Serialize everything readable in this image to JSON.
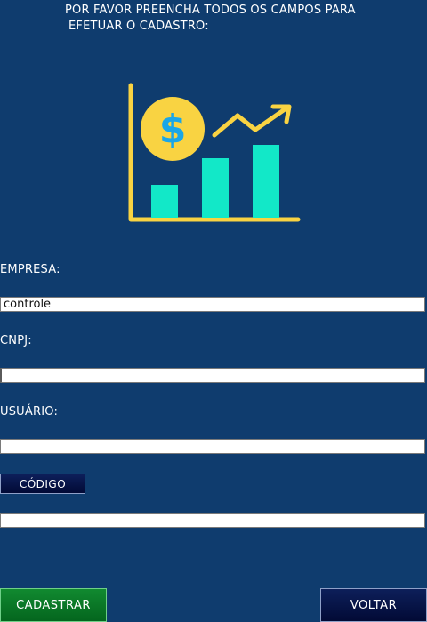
{
  "header": {
    "instruction_line1": "POR FAVOR PREENCHA TODOS OS CAMPOS PARA",
    "instruction_line2": "EFETUAR O CADASTRO:"
  },
  "logo": {
    "icon": "finance-growth-chart-icon",
    "colors": {
      "axis": "#f9d342",
      "coin": "#f9d342",
      "dollar": "#1aa6e8",
      "bars": "#12e8c8",
      "arrow": "#f9d342"
    }
  },
  "form": {
    "empresa": {
      "label": "EMPRESA:",
      "value": "controle"
    },
    "cnpj": {
      "label": "CNPJ:",
      "value": ""
    },
    "usuario": {
      "label": "USUÁRIO:",
      "value": ""
    },
    "codigo": {
      "button_label": "CÓDIGO",
      "value": ""
    }
  },
  "actions": {
    "cadastrar_label": "CADASTRAR",
    "voltar_label": "VOLTAR"
  },
  "colors": {
    "background": "#0f3c6e",
    "primary_action": "#0b7a28",
    "secondary_action": "#071648"
  }
}
